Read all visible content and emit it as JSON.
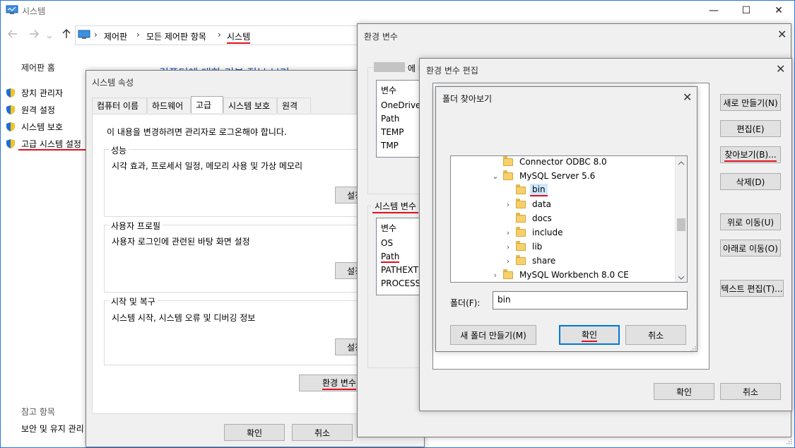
{
  "main_window": {
    "title": "시스템",
    "back_icon": "arrow-left",
    "forward_icon": "arrow-right",
    "up_icon": "arrow-up",
    "breadcrumb": [
      "제어판",
      "모든 제어판 항목",
      "시스템"
    ],
    "breadcrumb_sep": "›",
    "left_nav": {
      "home": "제어판 홈",
      "items": [
        "장치 관리자",
        "원격 설정",
        "시스템 보호",
        "고급 시스템 설정"
      ],
      "see_also_title": "참고 항목",
      "see_also_items": [
        "보안 및 유지 관리"
      ]
    },
    "partial_heading": "컴퓨터에 대한 기본 정보 보기",
    "minimize": "—",
    "maximize": "☐",
    "close": "✕"
  },
  "sys_props": {
    "title": "시스템 속성",
    "tabs": [
      "컴퓨터 이름",
      "하드웨어",
      "고급",
      "시스템 보호",
      "원격"
    ],
    "active_tab": "고급",
    "admin_note": "이 내용을 변경하려면 관리자로 로그온해야 합니다.",
    "groups": [
      {
        "title": "성능",
        "desc": "시각 효과, 프로세서 일정, 메모리 사용 및 가상 메모리",
        "button": "설정"
      },
      {
        "title": "사용자 프로필",
        "desc": "사용자 로그인에 관련된 바탕 화면 설정",
        "button": "설정"
      },
      {
        "title": "시작 및 복구",
        "desc": "시스템 시작, 시스템 오류 및 디버깅 정보",
        "button": "설정"
      }
    ],
    "env_button": "환경 변수",
    "ok": "확인",
    "cancel": "취소"
  },
  "env_vars": {
    "title": "환경 변수",
    "user_section_suffix": "에 대",
    "col_header": "변수",
    "user_vars": [
      "OneDrive",
      "Path",
      "TEMP",
      "TMP"
    ],
    "system_section": "시스템 변수",
    "system_vars": [
      "OS",
      "Path",
      "PATHEXT",
      "PROCESSO"
    ]
  },
  "env_edit": {
    "title": "환경 변수 편집",
    "buttons": [
      "새로 만들기(N)",
      "편집(E)",
      "찾아보기(B)...",
      "삭제(D)",
      "위로 이동(U)",
      "아래로 이동(O)",
      "텍스트 편집(T)..."
    ],
    "ok": "확인",
    "cancel": "취소"
  },
  "folder_browser": {
    "title": "폴더 찾아보기",
    "tree": [
      {
        "label": "Connector ODBC 8.0",
        "chevron": "",
        "level": 0
      },
      {
        "label": "MySQL Server 5.6",
        "chevron": "⌄",
        "level": 0
      },
      {
        "label": "bin",
        "chevron": "",
        "level": 1,
        "selected": true
      },
      {
        "label": "data",
        "chevron": "›",
        "level": 1
      },
      {
        "label": "docs",
        "chevron": "",
        "level": 1
      },
      {
        "label": "include",
        "chevron": "›",
        "level": 1
      },
      {
        "label": "lib",
        "chevron": "›",
        "level": 1
      },
      {
        "label": "share",
        "chevron": "›",
        "level": 1
      },
      {
        "label": "MySQL Workbench 8.0 CE",
        "chevron": "›",
        "level": 0
      }
    ],
    "folder_label": "폴더(F):",
    "folder_value": "bin",
    "new_folder": "새 폴더 만들기(M)",
    "ok": "확인",
    "cancel": "취소"
  },
  "colors": {
    "accent": "#0078d7",
    "underline": "#e01020",
    "link": "#1a4fb0",
    "selection": "#cce8ff"
  }
}
